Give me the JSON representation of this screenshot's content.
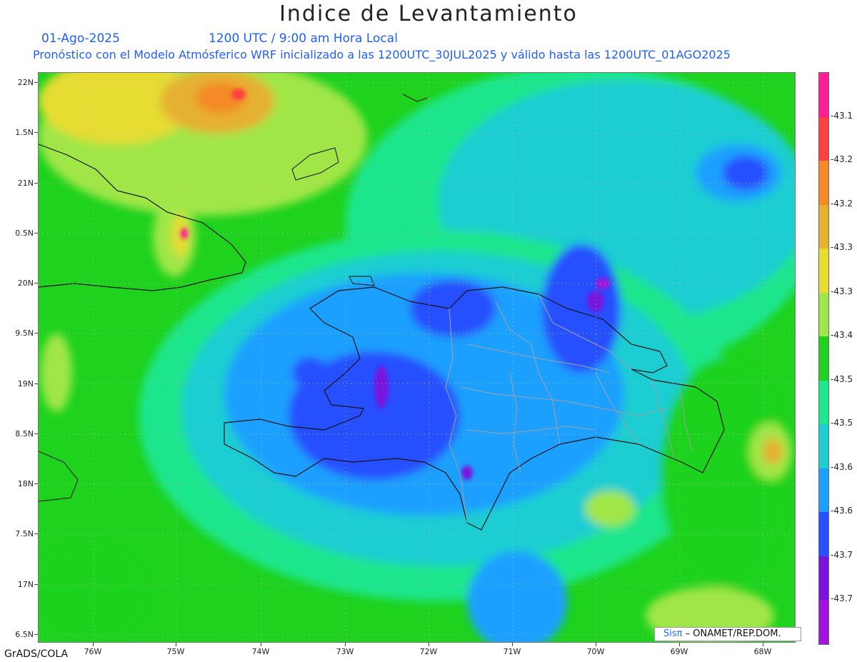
{
  "header": {
    "title": "Indice de Levantamiento",
    "date": "01-Ago-2025",
    "time": "1200 UTC / 9:00 am Hora Local",
    "forecast_info": "Pronóstico con el Modelo Atmósferico WRF inicializado a las 1200UTC_30JUL2025 y válido hasta las  1200UTC_01AGO2025"
  },
  "map": {
    "lat_labels": [
      "22N",
      "1.5N",
      "21N",
      "0.5N",
      "20N",
      "9.5N",
      "19N",
      "8.5N",
      "18N",
      "7.5N",
      "17N",
      "6.5N"
    ],
    "lon_labels": [
      "76W",
      "75W",
      "74W",
      "73W",
      "72W",
      "71W",
      "70W",
      "69W",
      "68W"
    ],
    "field_levels": [
      "-43.7",
      "-43.7",
      "-43.6",
      "-43.6",
      "-43.5",
      "-43.5",
      "-43.4",
      "-43.3",
      "-43.3",
      "-43.2",
      "-43.2",
      "-43.1"
    ]
  },
  "colorbar": {
    "colors": [
      "#ff1e96",
      "#ff4040",
      "#f58a28",
      "#e6b030",
      "#e6dc32",
      "#a0e646",
      "#1ed21e",
      "#1ee68c",
      "#1ecdd2",
      "#1ea0ff",
      "#2850ff",
      "#7814dc",
      "#a014dc"
    ],
    "labels": [
      "-43.1",
      "-43.2",
      "-43.2",
      "-43.3",
      "-43.3",
      "-43.4",
      "-43.5",
      "-43.5",
      "-43.6",
      "-43.6",
      "-43.7",
      "-43.7"
    ]
  },
  "footer": {
    "left_text": "GrADS/COLA",
    "credit_sis": "Sisπ",
    "credit_org": " –  ONAMET/REP.DOM."
  }
}
